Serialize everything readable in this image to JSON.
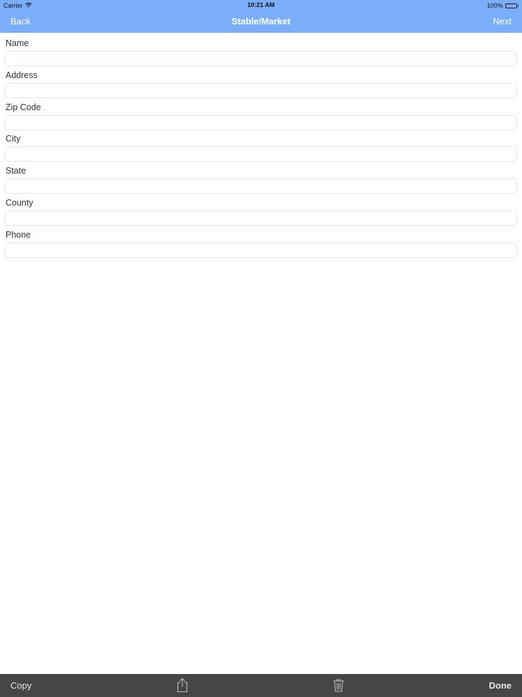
{
  "status_bar": {
    "carrier": "Carrier",
    "time": "10:21 AM",
    "battery": "100%",
    "icons": [
      "wifi-icon",
      "battery-icon"
    ]
  },
  "nav": {
    "back_label": "Back",
    "title": "Stable/Market",
    "next_label": "Next",
    "bar_color": "#7aaefa"
  },
  "form": {
    "fields": [
      {
        "label": "Name",
        "value": "",
        "placeholder": ""
      },
      {
        "label": "Address",
        "value": "",
        "placeholder": ""
      },
      {
        "label": "Zip Code",
        "value": "",
        "placeholder": ""
      },
      {
        "label": "City",
        "value": "",
        "placeholder": ""
      },
      {
        "label": "State",
        "value": "",
        "placeholder": ""
      },
      {
        "label": "County",
        "value": "",
        "placeholder": ""
      },
      {
        "label": "Phone",
        "value": "",
        "placeholder": ""
      }
    ]
  },
  "toolbar": {
    "copy_label": "Copy",
    "share_icon": "share-icon",
    "trash_icon": "trash-icon",
    "done_label": "Done",
    "bar_color": "#464646"
  }
}
